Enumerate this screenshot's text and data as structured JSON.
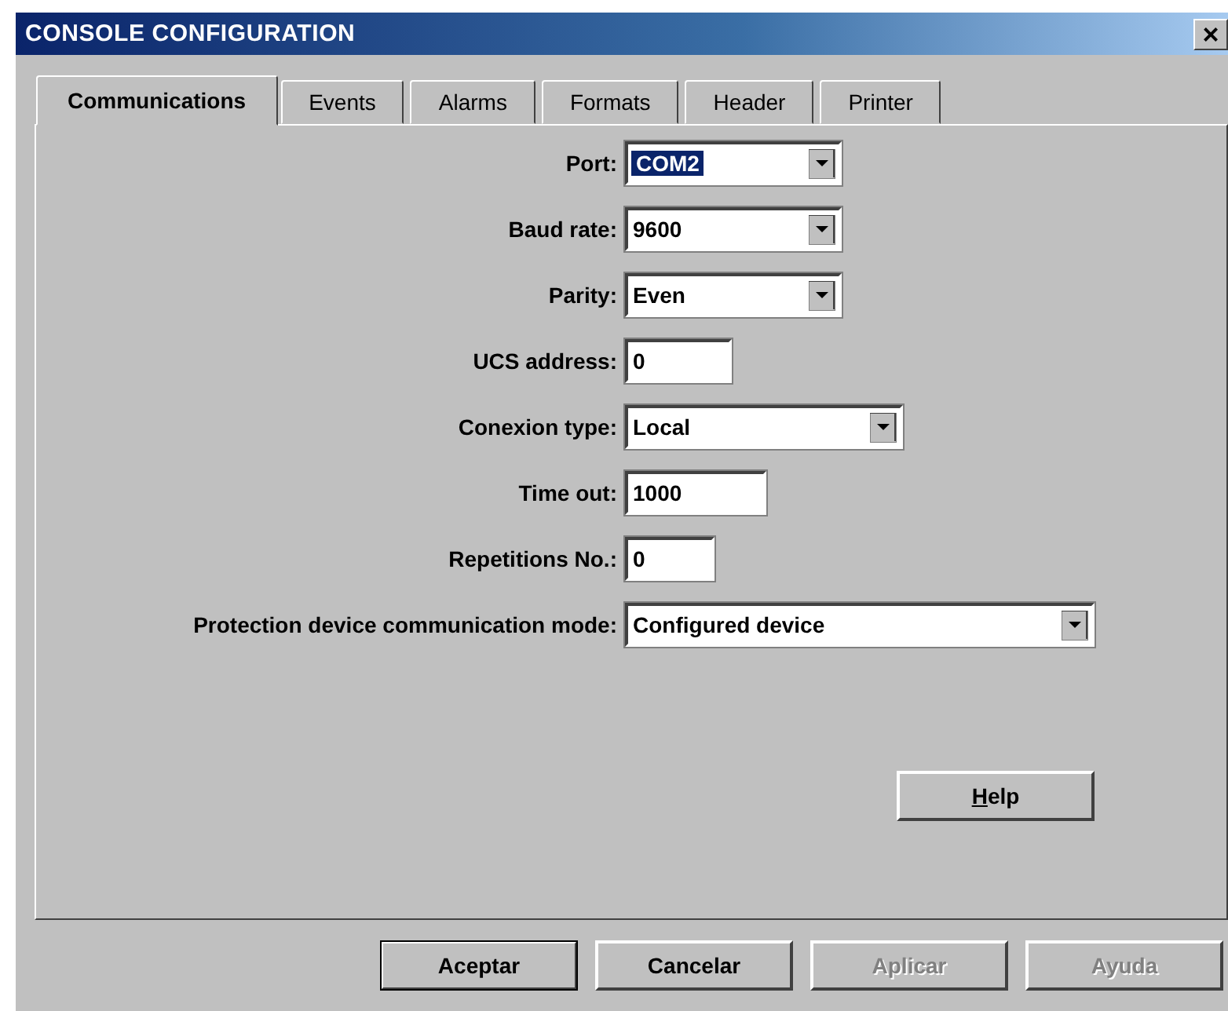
{
  "window": {
    "title": "CONSOLE CONFIGURATION",
    "close": "×"
  },
  "tabs": [
    {
      "label": "Communications",
      "selected": true
    },
    {
      "label": "Events",
      "selected": false
    },
    {
      "label": "Alarms",
      "selected": false
    },
    {
      "label": "Formats",
      "selected": false
    },
    {
      "label": "Header",
      "selected": false
    },
    {
      "label": "Printer",
      "selected": false
    }
  ],
  "fields": [
    {
      "label": "Port:",
      "kind": "combo",
      "value": "COM2",
      "focused": true
    },
    {
      "label": "Baud rate:",
      "kind": "combo",
      "value": "9600",
      "focused": false
    },
    {
      "label": "Parity:",
      "kind": "combo",
      "value": "Even",
      "focused": false
    },
    {
      "label": "UCS address:",
      "kind": "text",
      "value": "0",
      "focused": false
    },
    {
      "label": "Conexion type:",
      "kind": "combo",
      "value": "Local",
      "focused": false
    },
    {
      "label": "Time out:",
      "kind": "text",
      "value": "1000",
      "focused": false
    },
    {
      "label": "Repetitions No.:",
      "kind": "text",
      "value": "0",
      "focused": false
    },
    {
      "label": "Protection device communication mode:",
      "kind": "combo",
      "value": "Configured device",
      "focused": false
    }
  ],
  "help_button": "Help",
  "buttons": [
    {
      "label": "Aceptar",
      "default": true,
      "disabled": false
    },
    {
      "label": "Cancelar",
      "default": false,
      "disabled": false
    },
    {
      "label": "Aplicar",
      "default": false,
      "disabled": true
    },
    {
      "label": "Ayuda",
      "default": false,
      "disabled": true
    }
  ]
}
